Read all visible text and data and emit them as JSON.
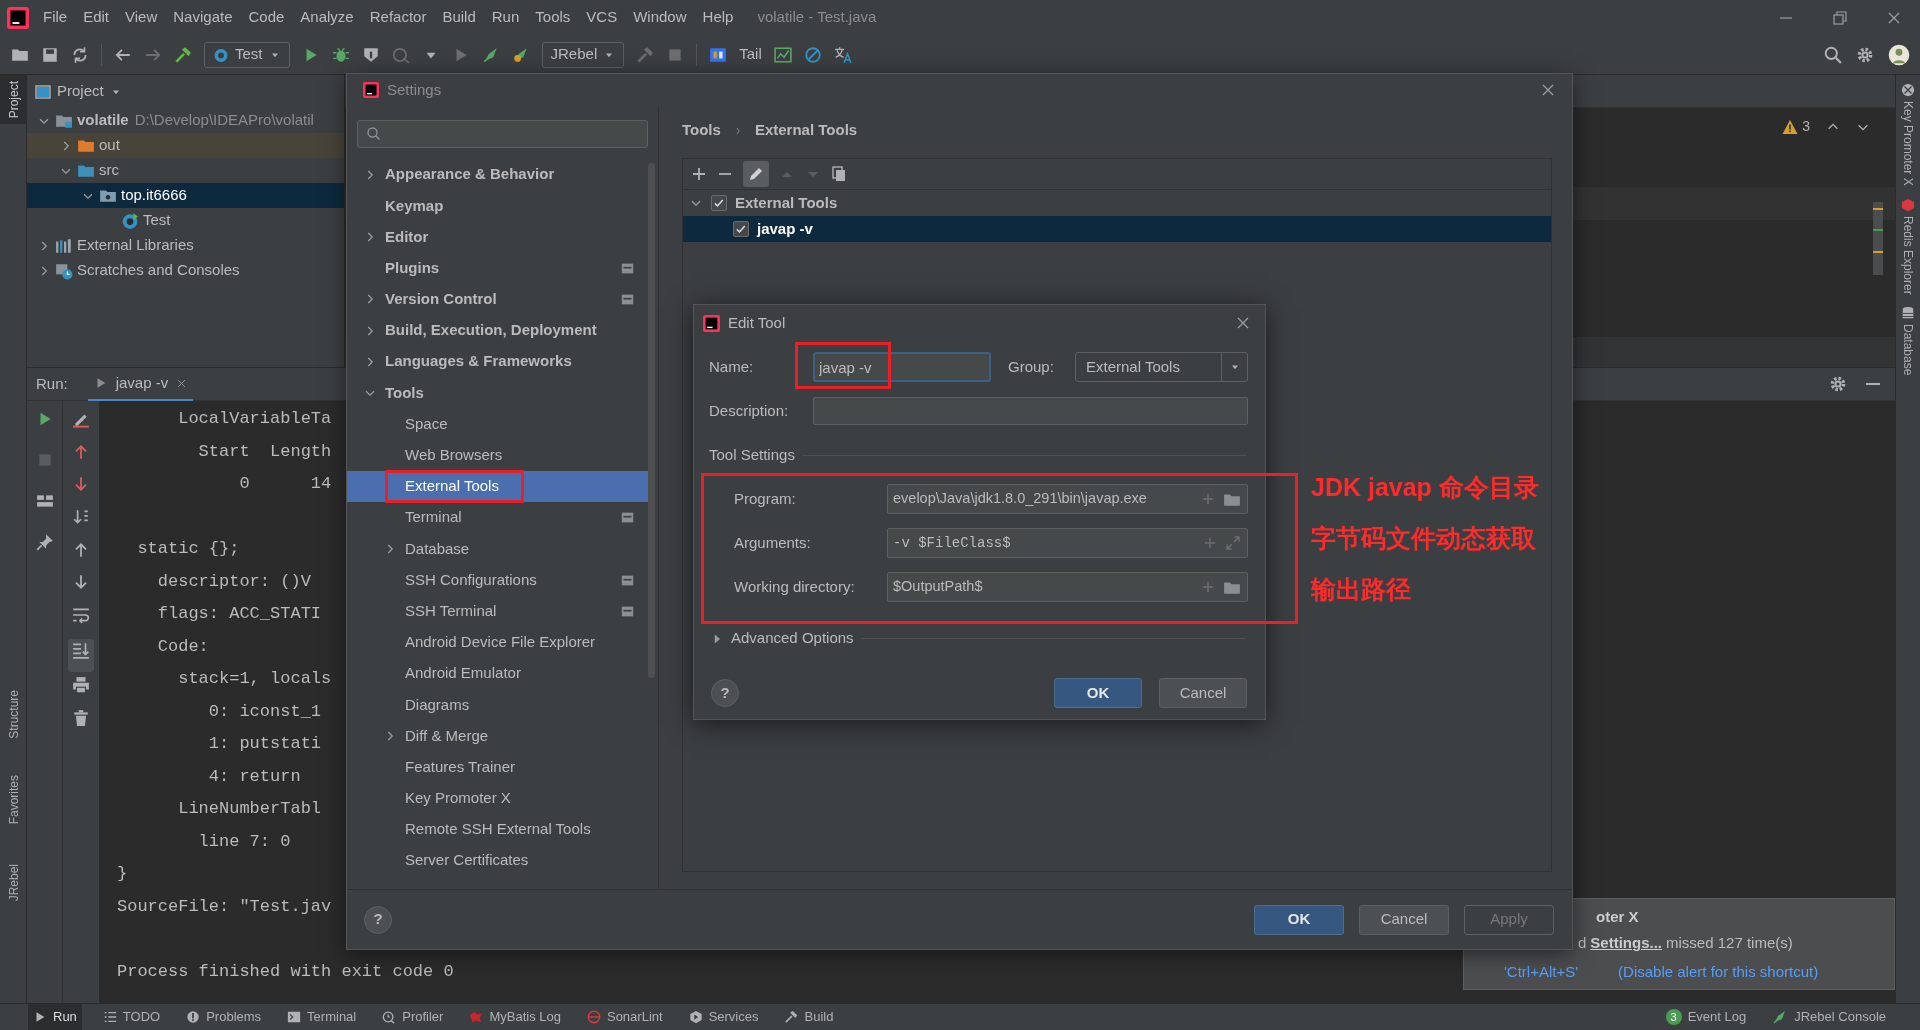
{
  "menu_bar": {
    "items": [
      "File",
      "Edit",
      "View",
      "Navigate",
      "Code",
      "Analyze",
      "Refactor",
      "Build",
      "Run",
      "Tools",
      "VCS",
      "Window",
      "Help"
    ],
    "title": "volatile - Test.java"
  },
  "toolbar": {
    "run_config": "Test",
    "jrebel_config": "JRebel",
    "tail": "Tail"
  },
  "left_tool_strip": [
    {
      "label": "Project",
      "selected": true
    },
    {
      "label": "Structure",
      "selected": false
    },
    {
      "label": "Favorites",
      "selected": false
    },
    {
      "label": "JRebel",
      "selected": false
    }
  ],
  "right_tool_strip": [
    "Key Promoter X",
    "Redis Explorer",
    "Database"
  ],
  "project_panel": {
    "title": "Project",
    "tree": [
      {
        "label": "volatile",
        "path": "D:\\Develop\\IDEAPro\\volatil",
        "kind": "module",
        "expanded": true,
        "selected": false,
        "children": [
          {
            "label": "out",
            "kind": "excluded",
            "expanded": false,
            "selected": false
          },
          {
            "label": "src",
            "kind": "source",
            "expanded": true,
            "selected": false,
            "children": [
              {
                "label": "top.it6666",
                "kind": "package",
                "expanded": true,
                "selected": true,
                "children": [
                  {
                    "label": "Test",
                    "kind": "class",
                    "selected": false
                  }
                ]
              }
            ]
          }
        ]
      },
      {
        "label": "External Libraries",
        "kind": "libraries",
        "expanded": false,
        "selected": false
      },
      {
        "label": "Scratches and Consoles",
        "kind": "scratches",
        "expanded": false,
        "selected": false
      }
    ]
  },
  "editor": {
    "warnings": "3"
  },
  "run_panel": {
    "label": "Run:",
    "tab": "javap -v",
    "console_blocks": [
      [
        "      LocalVariableTa",
        "        Start  Length",
        "            0      14"
      ],
      [
        "  static {};",
        "    descriptor: ()V",
        "    flags: ACC_STATI",
        "    Code:",
        "      stack=1, locals",
        "         0: iconst_1",
        "         1: putstati",
        "         4: return",
        "      LineNumberTabl",
        "        line 7: 0",
        "}",
        "SourceFile: \"Test.jav"
      ],
      [
        "Process finished with exit code 0"
      ]
    ]
  },
  "settings": {
    "title": "Settings",
    "sidebar": [
      {
        "label": "Appearance & Behavior",
        "kind": "group",
        "expanded": false,
        "selected": false,
        "project_scoped": false
      },
      {
        "label": "Keymap",
        "kind": "item",
        "selected": false,
        "project_scoped": false
      },
      {
        "label": "Editor",
        "kind": "group",
        "expanded": false,
        "selected": false,
        "project_scoped": false
      },
      {
        "label": "Plugins",
        "kind": "item",
        "selected": false,
        "project_scoped": true
      },
      {
        "label": "Version Control",
        "kind": "group",
        "expanded": false,
        "selected": false,
        "project_scoped": true
      },
      {
        "label": "Build, Execution, Deployment",
        "kind": "group",
        "expanded": false,
        "selected": false,
        "project_scoped": false
      },
      {
        "label": "Languages & Frameworks",
        "kind": "group",
        "expanded": false,
        "selected": false,
        "project_scoped": false
      },
      {
        "label": "Tools",
        "kind": "group",
        "expanded": true,
        "selected": false,
        "project_scoped": false,
        "children": [
          {
            "label": "Space",
            "kind": "item",
            "selected": false,
            "project_scoped": false
          },
          {
            "label": "Web Browsers",
            "kind": "item",
            "selected": false,
            "project_scoped": false
          },
          {
            "label": "External Tools",
            "kind": "item",
            "selected": true,
            "project_scoped": false
          },
          {
            "label": "Terminal",
            "kind": "item",
            "selected": false,
            "project_scoped": true
          },
          {
            "label": "Database",
            "kind": "group",
            "expanded": false,
            "selected": false,
            "project_scoped": false
          },
          {
            "label": "SSH Configurations",
            "kind": "item",
            "selected": false,
            "project_scoped": true
          },
          {
            "label": "SSH Terminal",
            "kind": "item",
            "selected": false,
            "project_scoped": true
          },
          {
            "label": "Android Device File Explorer",
            "kind": "item",
            "selected": false,
            "project_scoped": false
          },
          {
            "label": "Android Emulator",
            "kind": "item",
            "selected": false,
            "project_scoped": false
          },
          {
            "label": "Diagrams",
            "kind": "item",
            "selected": false,
            "project_scoped": false
          },
          {
            "label": "Diff & Merge",
            "kind": "group",
            "expanded": false,
            "selected": false,
            "project_scoped": false
          },
          {
            "label": "Features Trainer",
            "kind": "item",
            "selected": false,
            "project_scoped": false
          },
          {
            "label": "Key Promoter X",
            "kind": "item",
            "selected": false,
            "project_scoped": false
          },
          {
            "label": "Remote SSH External Tools",
            "kind": "item",
            "selected": false,
            "project_scoped": false
          },
          {
            "label": "Server Certificates",
            "kind": "item",
            "selected": false,
            "project_scoped": false
          }
        ]
      }
    ],
    "breadcrumb": [
      "Tools",
      "External Tools"
    ],
    "tools_tree": [
      {
        "label": "External Tools",
        "checked": true,
        "expanded": true,
        "selected": false,
        "children": [
          {
            "label": "javap -v",
            "checked": true,
            "selected": true
          }
        ]
      }
    ],
    "help": "?",
    "buttons": [
      {
        "label": "OK",
        "kind": "primary"
      },
      {
        "label": "Cancel",
        "kind": "default"
      },
      {
        "label": "Apply",
        "kind": "disabled"
      }
    ]
  },
  "edit_tool": {
    "title": "Edit Tool",
    "name": {
      "label": "Name:",
      "value": "javap -v"
    },
    "group": {
      "label": "Group:",
      "value": "External Tools"
    },
    "description": {
      "label": "Description:"
    },
    "section": "Tool Settings",
    "fields": [
      {
        "label": "Program:",
        "value": "evelop\\Java\\jdk1.8.0_291\\bin\\javap.exe",
        "kind": "browse"
      },
      {
        "label": "Arguments:",
        "value": "-v $FileClass$",
        "kind": "expand"
      },
      {
        "label": "Working directory:",
        "value": "$OutputPath$",
        "kind": "browse"
      }
    ],
    "advanced": {
      "label": "Advanced Options",
      "expanded": false
    },
    "help": "?",
    "buttons": [
      {
        "label": "OK",
        "kind": "primary"
      },
      {
        "label": "Cancel",
        "kind": "default"
      }
    ]
  },
  "annotations": [
    "JDK javap 命令目录",
    "字节码文件动态获取",
    "输出路径"
  ],
  "notification": {
    "title": "oter X",
    "prefix": "d",
    "link": "Settings...",
    "message": "missed 127 time(s)",
    "actions": [
      "'Ctrl+Alt+S'",
      "(Disable alert for this shortcut)"
    ]
  },
  "status_bar": {
    "tools": [
      {
        "label": "Run",
        "selected": true
      },
      {
        "label": "TODO",
        "selected": false
      },
      {
        "label": "Problems",
        "selected": false
      },
      {
        "label": "Terminal",
        "selected": false
      },
      {
        "label": "Profiler",
        "selected": false
      },
      {
        "label": "MyBatis Log",
        "selected": false
      },
      {
        "label": "SonarLint",
        "selected": false
      },
      {
        "label": "Services",
        "selected": false
      },
      {
        "label": "Build",
        "selected": false
      }
    ],
    "event_log": {
      "count": "3",
      "label": "Event Log"
    },
    "jrebel": "JRebel Console"
  }
}
